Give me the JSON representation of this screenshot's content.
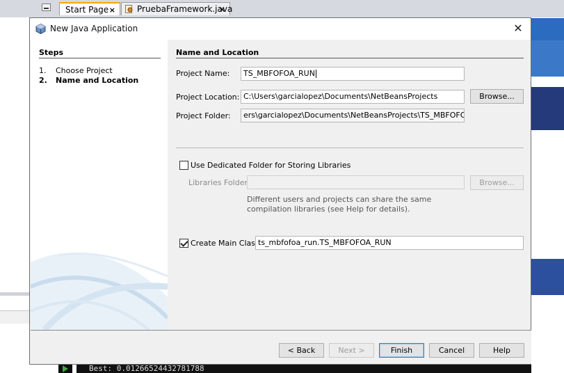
{
  "ide": {
    "tabs": [
      {
        "label": "Start Page",
        "close": "×"
      },
      {
        "label": "PruebaFramework.java",
        "close": "×"
      }
    ],
    "output_line": "Best: 0.01266524432781788"
  },
  "dialog": {
    "title": "New Java Application",
    "close_glyph": "✕",
    "steps": {
      "heading": "Steps",
      "items": [
        {
          "num": "1.",
          "label": "Choose Project"
        },
        {
          "num": "2.",
          "label": "Name and Location"
        }
      ]
    },
    "section_title": "Name and Location",
    "project_name": {
      "label": "Project Name:",
      "value": "TS_MBFOFOA_RUN"
    },
    "project_location": {
      "label": "Project Location:",
      "value": "C:\\Users\\garcialopez\\Documents\\NetBeansProjects",
      "browse": "Browse..."
    },
    "project_folder": {
      "label": "Project Folder:",
      "value": "ers\\garcialopez\\Documents\\NetBeansProjects\\TS_MBFOFOA_RUN"
    },
    "dedicated_folder": {
      "label": "Use Dedicated Folder for Storing Libraries",
      "checked": false
    },
    "libraries_folder": {
      "label": "Libraries Folder:",
      "value": "",
      "browse": "Browse..."
    },
    "help_text": "Different users and projects can share the same compilation libraries (see Help for details).",
    "main_class": {
      "label": "Create Main Class",
      "checked": true,
      "value": "ts_mbfofoa_run.TS_MBFOFOA_RUN"
    },
    "buttons": {
      "back": "< Back",
      "next": "Next >",
      "finish": "Finish",
      "cancel": "Cancel",
      "help": "Help"
    }
  },
  "colors": {
    "accent_blue": "#2b6bc0",
    "default_button_border": "#3c7fb1",
    "active_tab_marker": "#f6a800"
  }
}
